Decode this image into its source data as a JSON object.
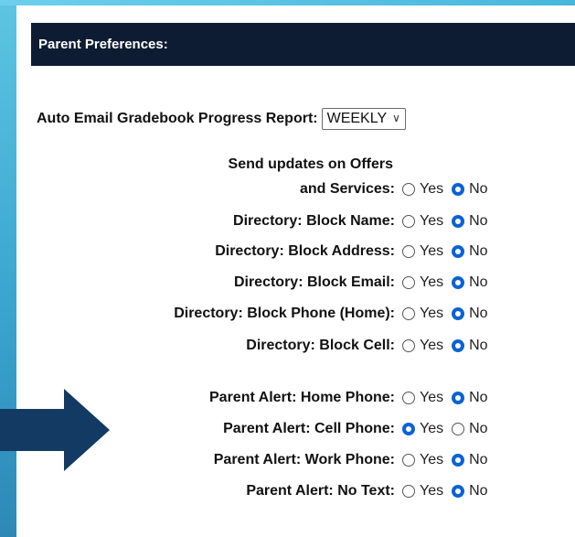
{
  "header": {
    "title": "Parent Preferences:"
  },
  "report": {
    "label": "Auto Email Gradebook Progress Report:",
    "selected": "WEEKLY"
  },
  "options": {
    "yes": "Yes",
    "no": "No"
  },
  "directory_group": [
    {
      "label_line1": "Send updates on Offers",
      "label_line2": "and Services:",
      "value": "No"
    },
    {
      "label": "Directory: Block Name:",
      "value": "No"
    },
    {
      "label": "Directory: Block Address:",
      "value": "No"
    },
    {
      "label": "Directory: Block Email:",
      "value": "No"
    },
    {
      "label": "Directory: Block Phone (Home):",
      "value": "No"
    },
    {
      "label": "Directory: Block Cell:",
      "value": "No"
    }
  ],
  "alert_group": [
    {
      "label": "Parent Alert: Home Phone:",
      "value": "No"
    },
    {
      "label": "Parent Alert: Cell Phone:",
      "value": "Yes"
    },
    {
      "label": "Parent Alert: Work Phone:",
      "value": "No"
    },
    {
      "label": "Parent Alert: No Text:",
      "value": "No"
    }
  ],
  "colors": {
    "header_bg": "#0e1c33",
    "radio_checked": "#0b62d6",
    "arrow": "#123a63",
    "accent_strip": "#3aa6cf"
  },
  "icons": {
    "arrow": "right-arrow-icon",
    "dropdown": "chevron-down-icon"
  }
}
